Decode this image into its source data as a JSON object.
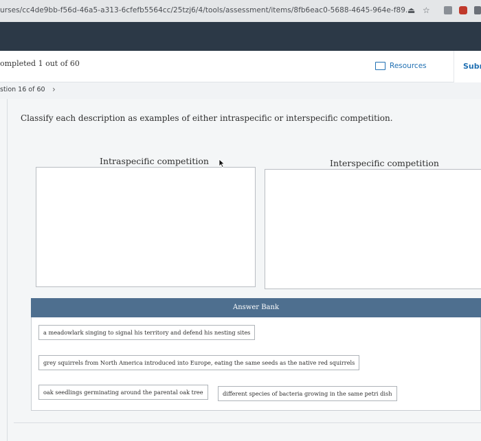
{
  "browser": {
    "url": "urses/cc4de9bb-f56d-46a5-a313-6cfefb5564cc/25tzj6/4/tools/assessment/items/8fb6eac0-5688-4645-964e-f89...",
    "share_icon": "share-icon",
    "bookmark_icon": "star-icon",
    "bookmark_glyph": "☆",
    "share_glyph": "⏏"
  },
  "header": {
    "progress": "ompleted 1 out of 60",
    "resources_label": "Resources",
    "submit_label": "Subm"
  },
  "question_nav": {
    "label": "stion 16 of 60",
    "next_glyph": "›"
  },
  "question": {
    "prompt": "Classify each description as examples of either intraspecific or interspecific competition."
  },
  "bins": [
    {
      "title": "Intraspecific competition"
    },
    {
      "title": "Interspecific competition"
    }
  ],
  "answer_bank": {
    "title": "Answer Bank",
    "items": [
      "a meadowlark singing to signal his territory and defend his nesting sites",
      "grey squirrels from North America introduced into Europe, eating the same seeds as the native red squirrels",
      "oak seedlings germinating around the parental oak tree",
      "different species of bacteria growing in the same petri dish"
    ]
  },
  "colors": {
    "top_band": "#2c3947",
    "answer_bank_header": "#4e6f8f",
    "accent": "#1f6fb2"
  }
}
